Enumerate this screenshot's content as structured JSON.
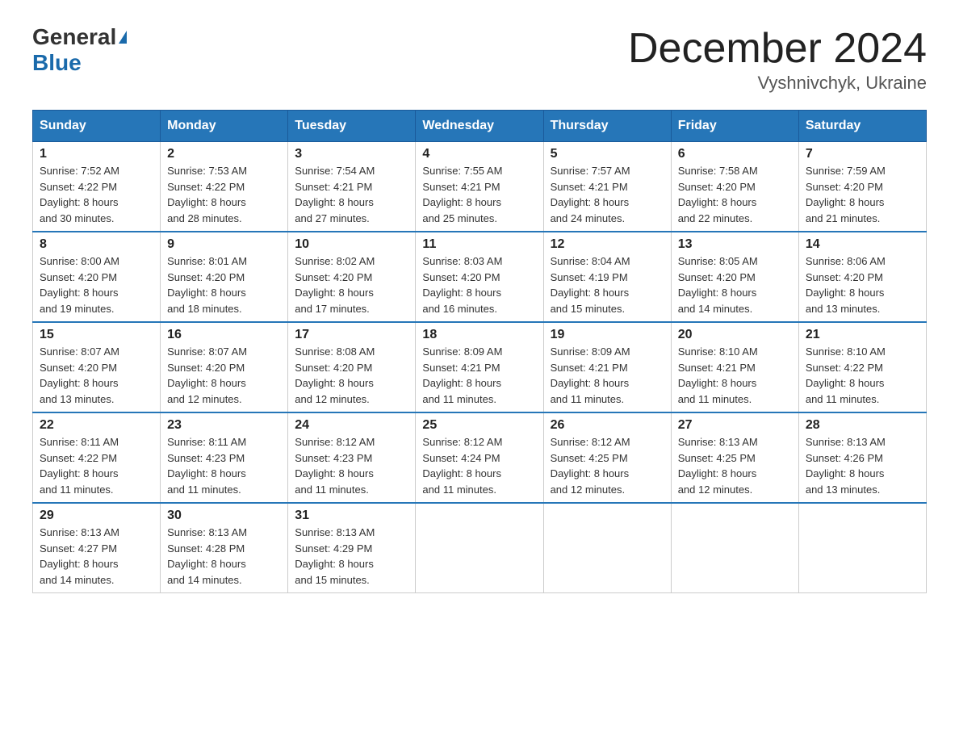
{
  "logo": {
    "general": "General",
    "blue": "Blue"
  },
  "title": "December 2024",
  "subtitle": "Vyshnivchyk, Ukraine",
  "days_of_week": [
    "Sunday",
    "Monday",
    "Tuesday",
    "Wednesday",
    "Thursday",
    "Friday",
    "Saturday"
  ],
  "weeks": [
    [
      {
        "day": "1",
        "info": "Sunrise: 7:52 AM\nSunset: 4:22 PM\nDaylight: 8 hours\nand 30 minutes."
      },
      {
        "day": "2",
        "info": "Sunrise: 7:53 AM\nSunset: 4:22 PM\nDaylight: 8 hours\nand 28 minutes."
      },
      {
        "day": "3",
        "info": "Sunrise: 7:54 AM\nSunset: 4:21 PM\nDaylight: 8 hours\nand 27 minutes."
      },
      {
        "day": "4",
        "info": "Sunrise: 7:55 AM\nSunset: 4:21 PM\nDaylight: 8 hours\nand 25 minutes."
      },
      {
        "day": "5",
        "info": "Sunrise: 7:57 AM\nSunset: 4:21 PM\nDaylight: 8 hours\nand 24 minutes."
      },
      {
        "day": "6",
        "info": "Sunrise: 7:58 AM\nSunset: 4:20 PM\nDaylight: 8 hours\nand 22 minutes."
      },
      {
        "day": "7",
        "info": "Sunrise: 7:59 AM\nSunset: 4:20 PM\nDaylight: 8 hours\nand 21 minutes."
      }
    ],
    [
      {
        "day": "8",
        "info": "Sunrise: 8:00 AM\nSunset: 4:20 PM\nDaylight: 8 hours\nand 19 minutes."
      },
      {
        "day": "9",
        "info": "Sunrise: 8:01 AM\nSunset: 4:20 PM\nDaylight: 8 hours\nand 18 minutes."
      },
      {
        "day": "10",
        "info": "Sunrise: 8:02 AM\nSunset: 4:20 PM\nDaylight: 8 hours\nand 17 minutes."
      },
      {
        "day": "11",
        "info": "Sunrise: 8:03 AM\nSunset: 4:20 PM\nDaylight: 8 hours\nand 16 minutes."
      },
      {
        "day": "12",
        "info": "Sunrise: 8:04 AM\nSunset: 4:19 PM\nDaylight: 8 hours\nand 15 minutes."
      },
      {
        "day": "13",
        "info": "Sunrise: 8:05 AM\nSunset: 4:20 PM\nDaylight: 8 hours\nand 14 minutes."
      },
      {
        "day": "14",
        "info": "Sunrise: 8:06 AM\nSunset: 4:20 PM\nDaylight: 8 hours\nand 13 minutes."
      }
    ],
    [
      {
        "day": "15",
        "info": "Sunrise: 8:07 AM\nSunset: 4:20 PM\nDaylight: 8 hours\nand 13 minutes."
      },
      {
        "day": "16",
        "info": "Sunrise: 8:07 AM\nSunset: 4:20 PM\nDaylight: 8 hours\nand 12 minutes."
      },
      {
        "day": "17",
        "info": "Sunrise: 8:08 AM\nSunset: 4:20 PM\nDaylight: 8 hours\nand 12 minutes."
      },
      {
        "day": "18",
        "info": "Sunrise: 8:09 AM\nSunset: 4:21 PM\nDaylight: 8 hours\nand 11 minutes."
      },
      {
        "day": "19",
        "info": "Sunrise: 8:09 AM\nSunset: 4:21 PM\nDaylight: 8 hours\nand 11 minutes."
      },
      {
        "day": "20",
        "info": "Sunrise: 8:10 AM\nSunset: 4:21 PM\nDaylight: 8 hours\nand 11 minutes."
      },
      {
        "day": "21",
        "info": "Sunrise: 8:10 AM\nSunset: 4:22 PM\nDaylight: 8 hours\nand 11 minutes."
      }
    ],
    [
      {
        "day": "22",
        "info": "Sunrise: 8:11 AM\nSunset: 4:22 PM\nDaylight: 8 hours\nand 11 minutes."
      },
      {
        "day": "23",
        "info": "Sunrise: 8:11 AM\nSunset: 4:23 PM\nDaylight: 8 hours\nand 11 minutes."
      },
      {
        "day": "24",
        "info": "Sunrise: 8:12 AM\nSunset: 4:23 PM\nDaylight: 8 hours\nand 11 minutes."
      },
      {
        "day": "25",
        "info": "Sunrise: 8:12 AM\nSunset: 4:24 PM\nDaylight: 8 hours\nand 11 minutes."
      },
      {
        "day": "26",
        "info": "Sunrise: 8:12 AM\nSunset: 4:25 PM\nDaylight: 8 hours\nand 12 minutes."
      },
      {
        "day": "27",
        "info": "Sunrise: 8:13 AM\nSunset: 4:25 PM\nDaylight: 8 hours\nand 12 minutes."
      },
      {
        "day": "28",
        "info": "Sunrise: 8:13 AM\nSunset: 4:26 PM\nDaylight: 8 hours\nand 13 minutes."
      }
    ],
    [
      {
        "day": "29",
        "info": "Sunrise: 8:13 AM\nSunset: 4:27 PM\nDaylight: 8 hours\nand 14 minutes."
      },
      {
        "day": "30",
        "info": "Sunrise: 8:13 AM\nSunset: 4:28 PM\nDaylight: 8 hours\nand 14 minutes."
      },
      {
        "day": "31",
        "info": "Sunrise: 8:13 AM\nSunset: 4:29 PM\nDaylight: 8 hours\nand 15 minutes."
      },
      null,
      null,
      null,
      null
    ]
  ]
}
